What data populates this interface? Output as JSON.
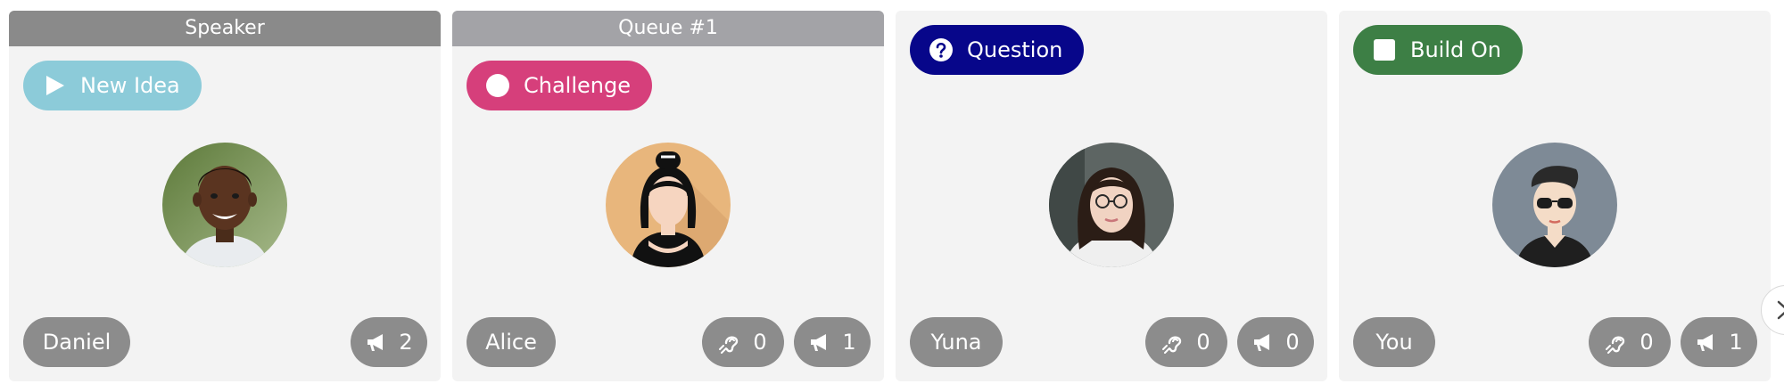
{
  "cards": [
    {
      "header": "Speaker",
      "tag": {
        "label": "New Idea",
        "icon": "play-icon",
        "color": "#8ccbd9"
      },
      "name": "Daniel",
      "avatar": "boy-photo-avatar",
      "speak_count": "2"
    },
    {
      "header": "Queue #1",
      "tag": {
        "label": "Challenge",
        "icon": "circle-icon",
        "color": "#d63f7b"
      },
      "name": "Alice",
      "avatar": "woman-illustration-avatar",
      "listen_count": "0",
      "speak_count": "1"
    },
    {
      "tag": {
        "label": "Question",
        "icon": "question-icon",
        "color": "#07068a"
      },
      "name": "Yuna",
      "avatar": "woman-glasses-photo-avatar",
      "listen_count": "0",
      "speak_count": "0"
    },
    {
      "tag": {
        "label": "Build On",
        "icon": "square-icon",
        "color": "#3d7f45"
      },
      "name": "You",
      "avatar": "man-sunglasses-illustration-avatar",
      "listen_count": "0",
      "speak_count": "1"
    }
  ],
  "colors": {
    "header_speaker": "#8a8a8a",
    "header_queue": "#a3a3a7",
    "card_bg": "#f3f3f3",
    "pill_bg": "#8c8c8c"
  },
  "next_button_icon": "chevron-right-icon"
}
